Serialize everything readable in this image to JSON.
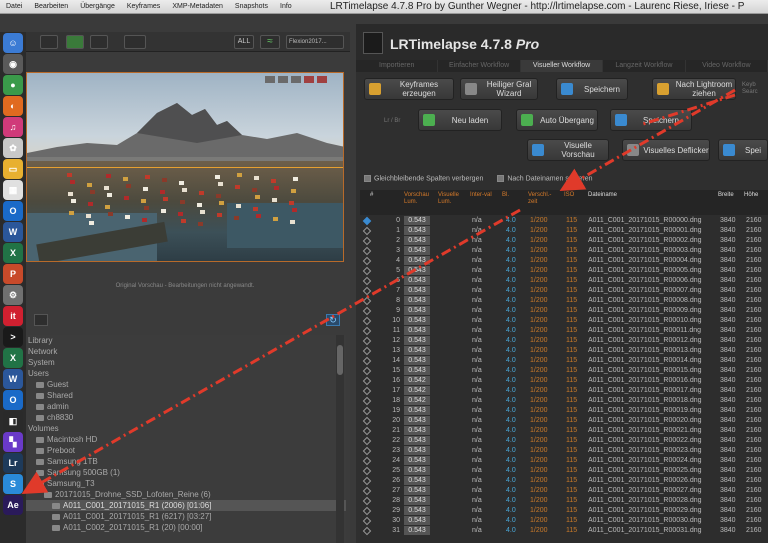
{
  "menubar": [
    "Datei",
    "Bearbeiten",
    "Übergänge",
    "Keyframes",
    "XMP-Metadaten",
    "Snapshots",
    "Info"
  ],
  "window_title": "LRTimelapse 4.7.8 Pro by Gunther Wegner - http://lrtimelapse.com - Laurenc Riese, Iriese - P",
  "app": {
    "title": "LRTimelapse 4.7.8 ",
    "title_suffix": "Pro"
  },
  "toolbar": {
    "all_label": "ALL",
    "select_value": "Flexion2017..."
  },
  "preview_caption": "Original Vorschau - Bearbeitungen nicht angewandt.",
  "tabs": [
    "Importieren",
    "Einfacher Workflow",
    "Visueller Workflow",
    "Langzeit Workflow",
    "Video Workflow"
  ],
  "active_tab": "Visueller Workflow",
  "workflow_buttons": [
    {
      "label": "Keyframes erzeugen",
      "color": "#d8a030"
    },
    {
      "label": "Heiliger Gral Wizard",
      "color": "#888888"
    },
    {
      "label": "Speichern",
      "color": "#3a8ad0"
    },
    {
      "label": "Nach Lightroom ziehen",
      "color": "#d8a030"
    },
    {
      "label": "Neu laden",
      "color": "#4caf50"
    },
    {
      "label": "Auto Übergang",
      "color": "#4caf50"
    },
    {
      "label": "Speichern",
      "color": "#3a8ad0"
    },
    {
      "label": "Visuelle Vorschau",
      "color": "#3a8ad0"
    },
    {
      "label": "Visuelles Deflicker",
      "color": "#888888"
    },
    {
      "label": "Spei",
      "color": "#3a8ad0"
    }
  ],
  "workflow_side_labels": {
    "lr_br": "Lr / Br",
    "keyb": "Keyb Searc"
  },
  "checks": {
    "hide_columns": "Gleichbleibende Spalten verbergen",
    "sort_by_date": "Nach Dateinamen sortieren"
  },
  "table": {
    "headers": [
      "#",
      "Vorschau Lum.",
      "Visuelle Lum.",
      "Inter-val",
      "Bl.",
      "Verschl.-zeit",
      "ISO",
      "Dateiname",
      "Breite",
      "Höhe"
    ],
    "aperture": "4.0",
    "shutter": "1/200",
    "iso": "115",
    "width": "3840",
    "height": "2160",
    "interval": "n/a",
    "rows": [
      {
        "n": "0",
        "lum": "0.543",
        "file": "A011_C001_20171015_R00000.dng"
      },
      {
        "n": "1",
        "lum": "0.543",
        "file": "A011_C001_20171015_R00001.dng"
      },
      {
        "n": "2",
        "lum": "0.543",
        "file": "A011_C001_20171015_R00002.dng"
      },
      {
        "n": "3",
        "lum": "0.543",
        "file": "A011_C001_20171015_R00003.dng"
      },
      {
        "n": "4",
        "lum": "0.543",
        "file": "A011_C001_20171015_R00004.dng"
      },
      {
        "n": "5",
        "lum": "0.543",
        "file": "A011_C001_20171015_R00005.dng"
      },
      {
        "n": "6",
        "lum": "0.543",
        "file": "A011_C001_20171015_R00006.dng"
      },
      {
        "n": "7",
        "lum": "0.543",
        "file": "A011_C001_20171015_R00007.dng"
      },
      {
        "n": "8",
        "lum": "0.543",
        "file": "A011_C001_20171015_R00008.dng"
      },
      {
        "n": "9",
        "lum": "0.543",
        "file": "A011_C001_20171015_R00009.dng"
      },
      {
        "n": "10",
        "lum": "0.543",
        "file": "A011_C001_20171015_R00010.dng"
      },
      {
        "n": "11",
        "lum": "0.543",
        "file": "A011_C001_20171015_R00011.dng"
      },
      {
        "n": "12",
        "lum": "0.543",
        "file": "A011_C001_20171015_R00012.dng"
      },
      {
        "n": "13",
        "lum": "0.543",
        "file": "A011_C001_20171015_R00013.dng"
      },
      {
        "n": "14",
        "lum": "0.543",
        "file": "A011_C001_20171015_R00014.dng"
      },
      {
        "n": "15",
        "lum": "0.543",
        "file": "A011_C001_20171015_R00015.dng"
      },
      {
        "n": "16",
        "lum": "0.542",
        "file": "A011_C001_20171015_R00016.dng"
      },
      {
        "n": "17",
        "lum": "0.542",
        "file": "A011_C001_20171015_R00017.dng"
      },
      {
        "n": "18",
        "lum": "0.542",
        "file": "A011_C001_20171015_R00018.dng"
      },
      {
        "n": "19",
        "lum": "0.543",
        "file": "A011_C001_20171015_R00019.dng"
      },
      {
        "n": "20",
        "lum": "0.543",
        "file": "A011_C001_20171015_R00020.dng"
      },
      {
        "n": "21",
        "lum": "0.543",
        "file": "A011_C001_20171015_R00021.dng"
      },
      {
        "n": "22",
        "lum": "0.543",
        "file": "A011_C001_20171015_R00022.dng"
      },
      {
        "n": "23",
        "lum": "0.543",
        "file": "A011_C001_20171015_R00023.dng"
      },
      {
        "n": "24",
        "lum": "0.543",
        "file": "A011_C001_20171015_R00024.dng"
      },
      {
        "n": "25",
        "lum": "0.543",
        "file": "A011_C001_20171015_R00025.dng"
      },
      {
        "n": "26",
        "lum": "0.543",
        "file": "A011_C001_20171015_R00026.dng"
      },
      {
        "n": "27",
        "lum": "0.543",
        "file": "A011_C001_20171015_R00027.dng"
      },
      {
        "n": "28",
        "lum": "0.543",
        "file": "A011_C001_20171015_R00028.dng"
      },
      {
        "n": "29",
        "lum": "0.543",
        "file": "A011_C001_20171015_R00029.dng"
      },
      {
        "n": "30",
        "lum": "0.543",
        "file": "A011_C001_20171015_R00030.dng"
      },
      {
        "n": "31",
        "lum": "0.543",
        "file": "A011_C001_20171015_R00031.dng"
      }
    ]
  },
  "tree": [
    {
      "label": "Library",
      "indent": 0,
      "folder": false
    },
    {
      "label": "Network",
      "indent": 0,
      "folder": false
    },
    {
      "label": "System",
      "indent": 0,
      "folder": false
    },
    {
      "label": "Users",
      "indent": 0,
      "folder": false
    },
    {
      "label": "Guest",
      "indent": 1,
      "folder": true
    },
    {
      "label": "Shared",
      "indent": 1,
      "folder": true
    },
    {
      "label": "admin",
      "indent": 1,
      "folder": true
    },
    {
      "label": "ch8830",
      "indent": 1,
      "folder": true
    },
    {
      "label": "Volumes",
      "indent": 0,
      "folder": false
    },
    {
      "label": "Macintosh HD",
      "indent": 1,
      "folder": true
    },
    {
      "label": "Preboot",
      "indent": 1,
      "folder": true
    },
    {
      "label": "Samsung 1TB",
      "indent": 1,
      "folder": true
    },
    {
      "label": "Samsung 500GB (1)",
      "indent": 1,
      "folder": true
    },
    {
      "label": "Samsung_T3",
      "indent": 1,
      "folder": true
    },
    {
      "label": "20171015_Drohne_SSD_Lofoten_Reine (6)",
      "indent": 2,
      "folder": true
    },
    {
      "label": "A011_C001_20171015_R1 (2006) [01:06]",
      "indent": 3,
      "folder": true,
      "selected": true
    },
    {
      "label": "A011_C001_20171015_R1 (6217) [03:27]",
      "indent": 3,
      "folder": true
    },
    {
      "label": "A011_C002_20171015_R1 (20) [00:00]",
      "indent": 3,
      "folder": true
    }
  ],
  "dock_icons": [
    {
      "name": "finder-icon",
      "color": "#3b7bd4",
      "glyph": "☺"
    },
    {
      "name": "siri-icon",
      "color": "#5a5a5a",
      "glyph": "◉"
    },
    {
      "name": "chrome-icon",
      "color": "#3a9a4a",
      "glyph": "●"
    },
    {
      "name": "firefox-icon",
      "color": "#e06a20",
      "glyph": "◐"
    },
    {
      "name": "itunes-icon",
      "color": "#d03a7a",
      "glyph": "♫"
    },
    {
      "name": "photos-icon",
      "color": "#c8c8c8",
      "glyph": "✿"
    },
    {
      "name": "folder-icon",
      "color": "#e8b030",
      "glyph": "▭"
    },
    {
      "name": "calendar-icon",
      "color": "#e0e0e0",
      "glyph": "▦"
    },
    {
      "name": "outlook-icon",
      "color": "#1a6ac8",
      "glyph": "O"
    },
    {
      "name": "word-icon",
      "color": "#2b579a",
      "glyph": "W"
    },
    {
      "name": "excel-icon",
      "color": "#217346",
      "glyph": "X"
    },
    {
      "name": "powerpoint-icon",
      "color": "#c84a2a",
      "glyph": "P"
    },
    {
      "name": "settings-icon",
      "color": "#707070",
      "glyph": "⚙"
    },
    {
      "name": "it-icon",
      "color": "#d02030",
      "glyph": "it"
    },
    {
      "name": "terminal-icon",
      "color": "#1a1a1a",
      "glyph": ">"
    },
    {
      "name": "excel2-icon",
      "color": "#217346",
      "glyph": "X"
    },
    {
      "name": "word2-icon",
      "color": "#2b579a",
      "glyph": "W"
    },
    {
      "name": "outlook2-icon",
      "color": "#1a6ac8",
      "glyph": "O"
    },
    {
      "name": "lrt-icon",
      "color": "#2a2a2a",
      "glyph": "◧"
    },
    {
      "name": "mosaic-icon",
      "color": "#6a3ac8",
      "glyph": "▚"
    },
    {
      "name": "lightroom-icon",
      "color": "#1e3a5a",
      "glyph": "Lr"
    },
    {
      "name": "swift-icon",
      "color": "#2a8ad8",
      "glyph": "S"
    },
    {
      "name": "aftereffects-icon",
      "color": "#2a1a5a",
      "glyph": "Ae"
    }
  ]
}
